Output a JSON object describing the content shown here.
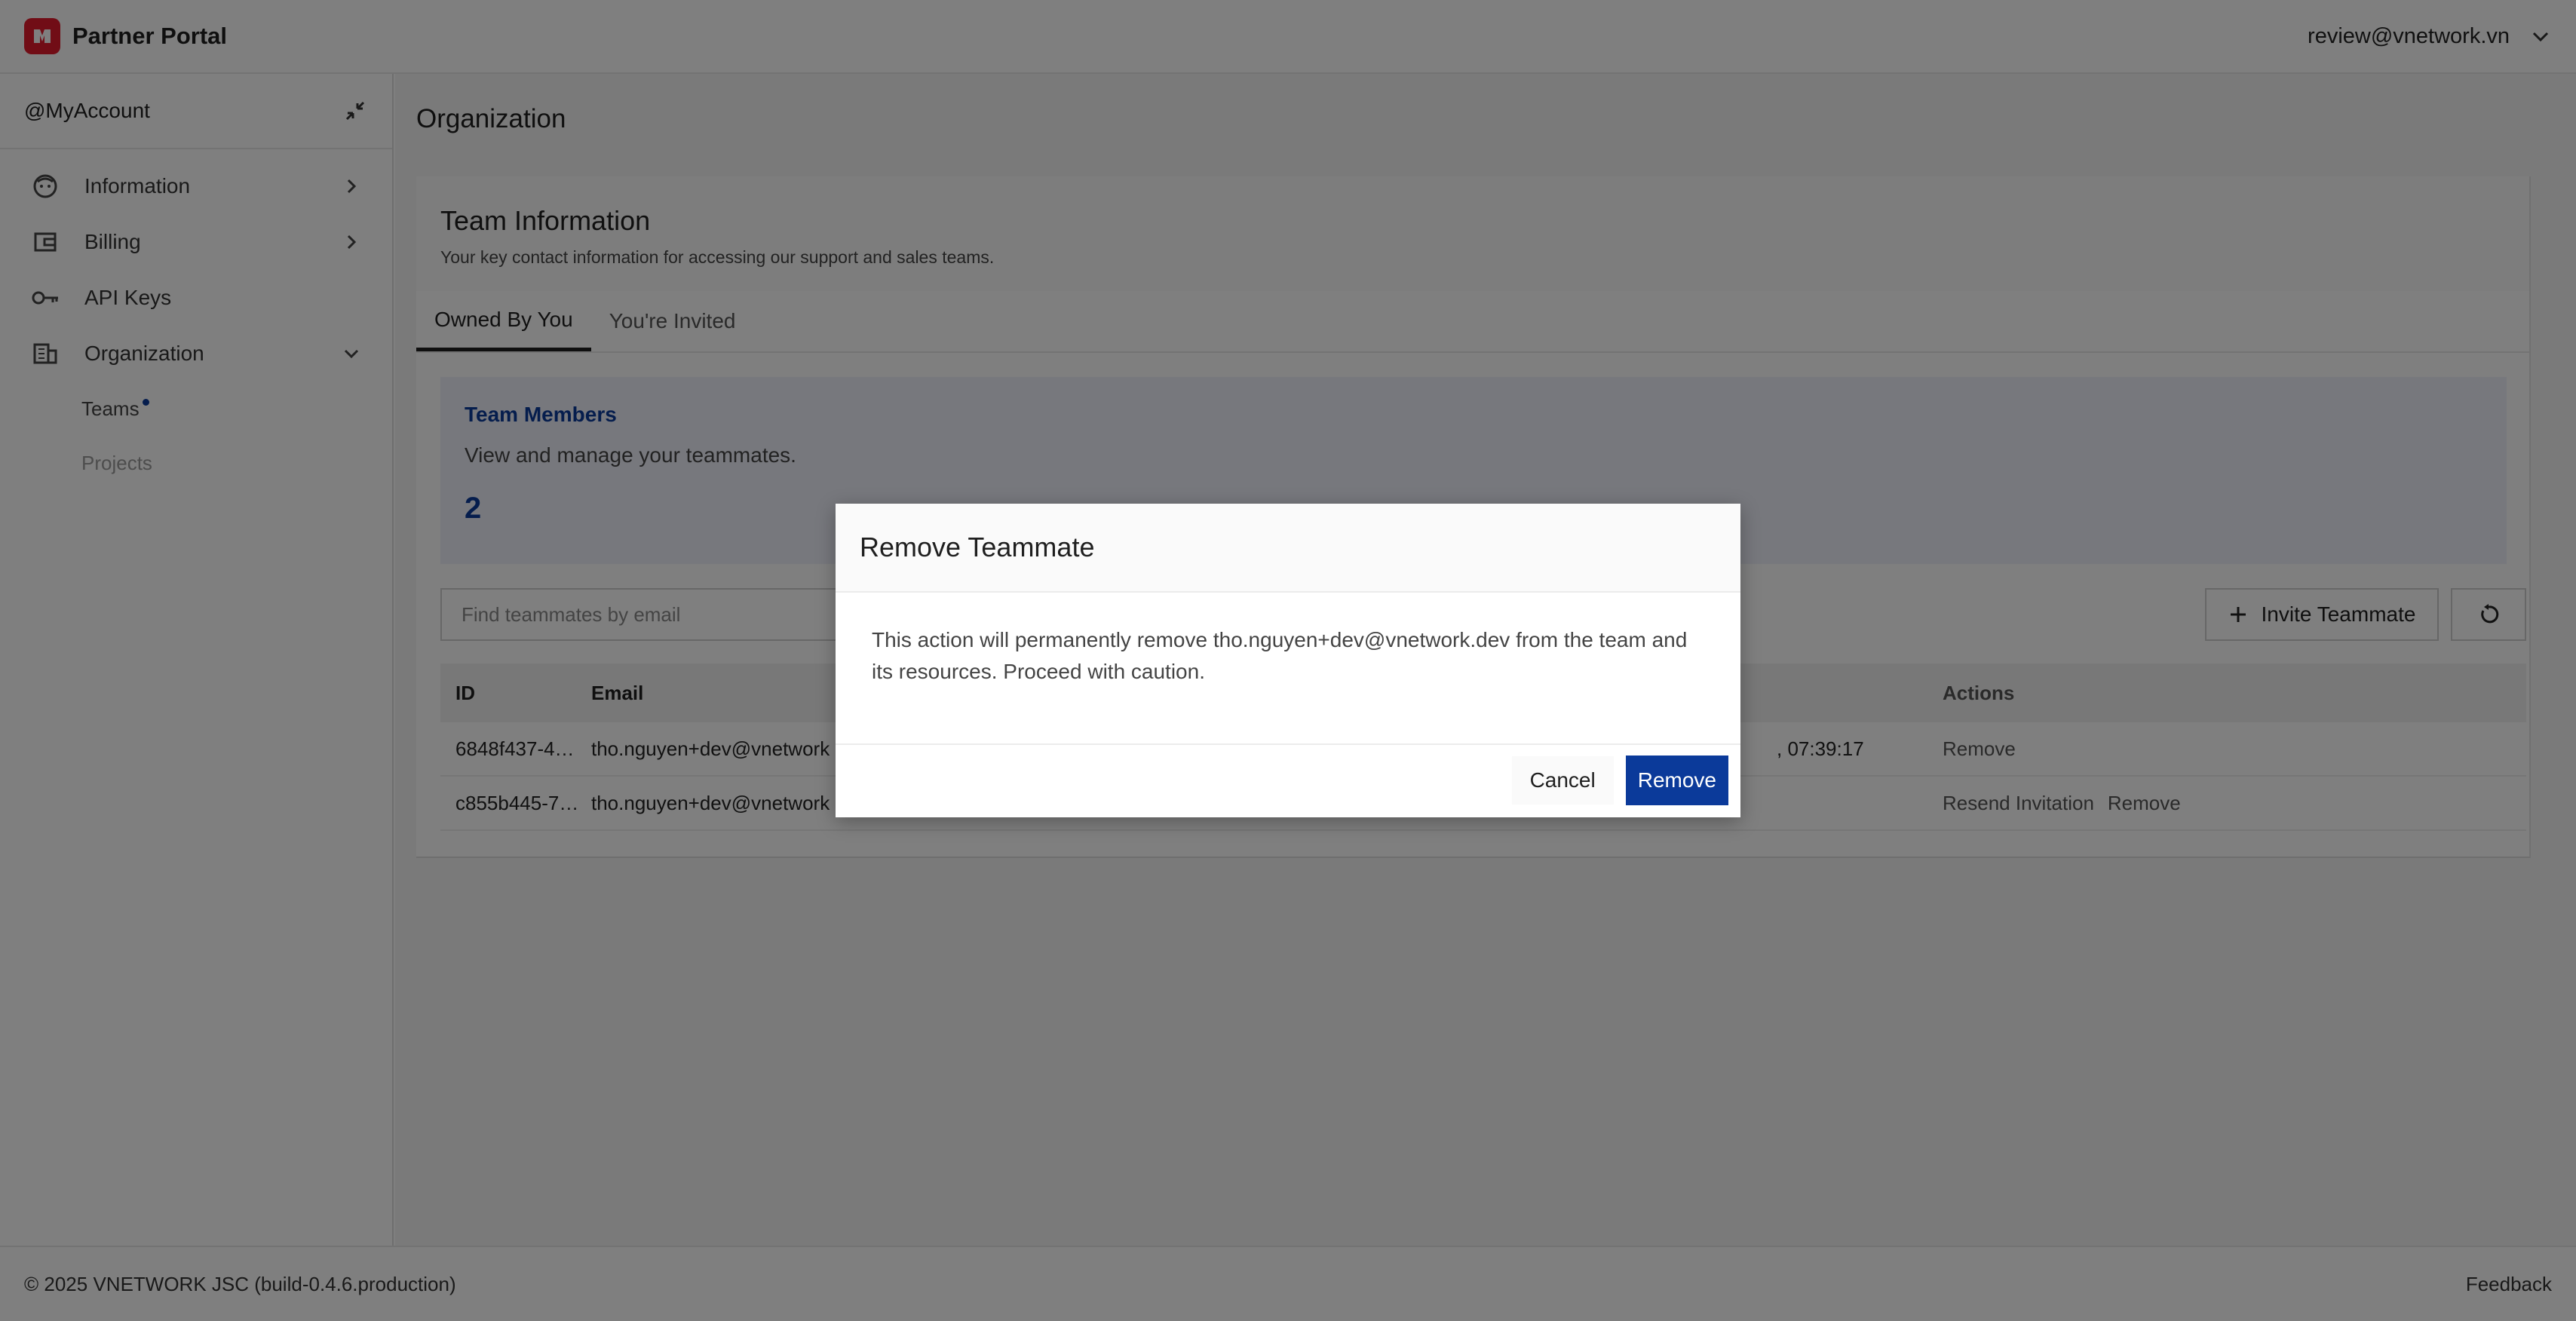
{
  "app": {
    "title": "Partner Portal",
    "user_email": "review@vnetwork.vn"
  },
  "sidebar": {
    "account": "@MyAccount",
    "items": [
      {
        "label": "Information",
        "icon": "face-icon"
      },
      {
        "label": "Billing",
        "icon": "wallet-icon"
      },
      {
        "label": "API Keys",
        "icon": "key-icon"
      },
      {
        "label": "Organization",
        "icon": "building-icon"
      }
    ],
    "subitems": [
      {
        "label": "Teams"
      },
      {
        "label": "Projects"
      }
    ]
  },
  "page": {
    "title": "Organization"
  },
  "team": {
    "title": "Team Information",
    "subtitle": "Your key contact information for accessing our support and sales teams.",
    "tabs": [
      "Owned By You",
      "You're Invited"
    ]
  },
  "members": {
    "title": "Team Members",
    "description": "View and manage your teammates.",
    "count": "2"
  },
  "search": {
    "placeholder": "Find teammates by email"
  },
  "toolbar": {
    "invite_label": "Invite Teammate"
  },
  "table": {
    "headers": {
      "id": "ID",
      "email": "Email",
      "actions": "Actions"
    },
    "rows": [
      {
        "id": "6848f437-4…",
        "email": "tho.nguyen+dev@vnetwork",
        "date": ", 07:39:17",
        "action1": "Remove",
        "action2": ""
      },
      {
        "id": "c855b445-7…",
        "email": "tho.nguyen+dev@vnetwork",
        "date": "",
        "action1": "Resend Invitation",
        "action2": "Remove"
      }
    ]
  },
  "footer": {
    "copyright": "© 2025 VNETWORK JSC (build-0.4.6.production)",
    "feedback": "Feedback"
  },
  "dialog": {
    "title": "Remove Teammate",
    "message": "This action will permanently remove tho.nguyen+dev@vnetwork.dev from the team and its resources. Proceed with caution.",
    "cancel_label": "Cancel",
    "confirm_label": "Remove"
  },
  "colors": {
    "brand": "#e21b2d",
    "accent": "#0b3a9a"
  }
}
